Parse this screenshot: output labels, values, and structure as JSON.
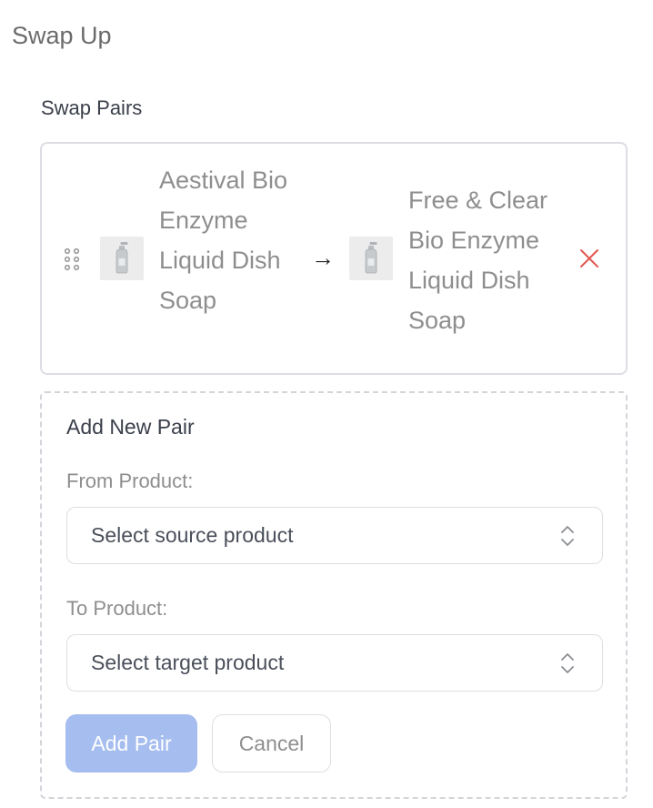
{
  "page": {
    "title": "Swap Up"
  },
  "swap_pairs": {
    "section_title": "Swap Pairs",
    "pairs": [
      {
        "from_name": "Aestival Bio Enzyme Liquid Dish Soap",
        "to_name": "Free & Clear Bio Enzyme Liquid Dish Soap",
        "arrow": "→"
      }
    ]
  },
  "add_pair": {
    "title": "Add New Pair",
    "from_label": "From Product:",
    "from_placeholder": "Select source product",
    "to_label": "To Product:",
    "to_placeholder": "Select target product",
    "add_button": "Add Pair",
    "cancel_button": "Cancel"
  },
  "colors": {
    "primary_disabled": "#a6bdef",
    "remove": "#e0584f",
    "border": "#dcdee3"
  },
  "icons": {
    "drag": "drag-handle-icon",
    "product": "dish-soap-bottle-icon",
    "remove": "close-icon",
    "chevron": "chevron-up-down-icon"
  }
}
